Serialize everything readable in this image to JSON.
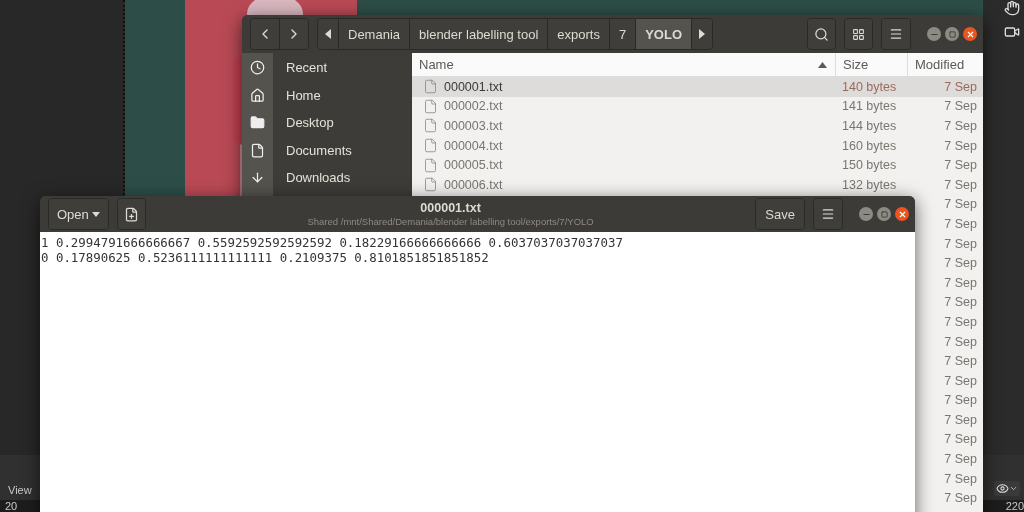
{
  "blender": {
    "header_menu": "View",
    "frame_start": "20",
    "frame_end": "220"
  },
  "file_manager": {
    "path": [
      {
        "label": "Demania",
        "selected": false
      },
      {
        "label": "blender labelling tool",
        "selected": false
      },
      {
        "label": "exports",
        "selected": false
      },
      {
        "label": "7",
        "selected": false
      },
      {
        "label": "YOLO",
        "selected": true
      }
    ],
    "sidebar": [
      {
        "kind": "recent",
        "label": "Recent"
      },
      {
        "kind": "home",
        "label": "Home"
      },
      {
        "kind": "folder",
        "label": "Desktop"
      },
      {
        "kind": "document",
        "label": "Documents"
      },
      {
        "kind": "download",
        "label": "Downloads"
      }
    ],
    "columns": [
      {
        "label": "Name",
        "sorted": true
      },
      {
        "label": "Size",
        "sorted": false
      },
      {
        "label": "Modified",
        "sorted": false
      }
    ],
    "rows": [
      {
        "name": "000001.txt",
        "size": "140 bytes",
        "modified": "7 Sep",
        "selected": true
      },
      {
        "name": "000002.txt",
        "size": "141 bytes",
        "modified": "7 Sep",
        "selected": false
      },
      {
        "name": "000003.txt",
        "size": "144 bytes",
        "modified": "7 Sep",
        "selected": false
      },
      {
        "name": "000004.txt",
        "size": "160 bytes",
        "modified": "7 Sep",
        "selected": false
      },
      {
        "name": "000005.txt",
        "size": "150 bytes",
        "modified": "7 Sep",
        "selected": false
      },
      {
        "name": "000006.txt",
        "size": "132 bytes",
        "modified": "7 Sep",
        "selected": false
      },
      {
        "modified": "7 Sep",
        "selected": false
      },
      {
        "modified": "7 Sep",
        "selected": false
      },
      {
        "modified": "7 Sep",
        "selected": false
      },
      {
        "modified": "7 Sep",
        "selected": false
      },
      {
        "modified": "7 Sep",
        "selected": false
      },
      {
        "modified": "7 Sep",
        "selected": false
      },
      {
        "modified": "7 Sep",
        "selected": false
      },
      {
        "modified": "7 Sep",
        "selected": false
      },
      {
        "modified": "7 Sep",
        "selected": false
      },
      {
        "modified": "7 Sep",
        "selected": false
      },
      {
        "modified": "7 Sep",
        "selected": false
      },
      {
        "modified": "7 Sep",
        "selected": false
      },
      {
        "modified": "7 Sep",
        "selected": false
      },
      {
        "modified": "7 Sep",
        "selected": false
      },
      {
        "modified": "7 Sep",
        "selected": false
      },
      {
        "modified": "7 Sep",
        "selected": false
      }
    ]
  },
  "text_editor": {
    "open_label": "Open",
    "title": "000001.txt",
    "subtitle": "Shared /mnt/Shared/Demania/blender labelling tool/exports/7/YOLO",
    "save_label": "Save",
    "lines": [
      "1 0.2994791666666667 0.5592592592592592 0.18229166666666666 0.6037037037037037",
      "0 0.17890625 0.5236111111111111 0.2109375 0.8101851851851852"
    ]
  }
}
